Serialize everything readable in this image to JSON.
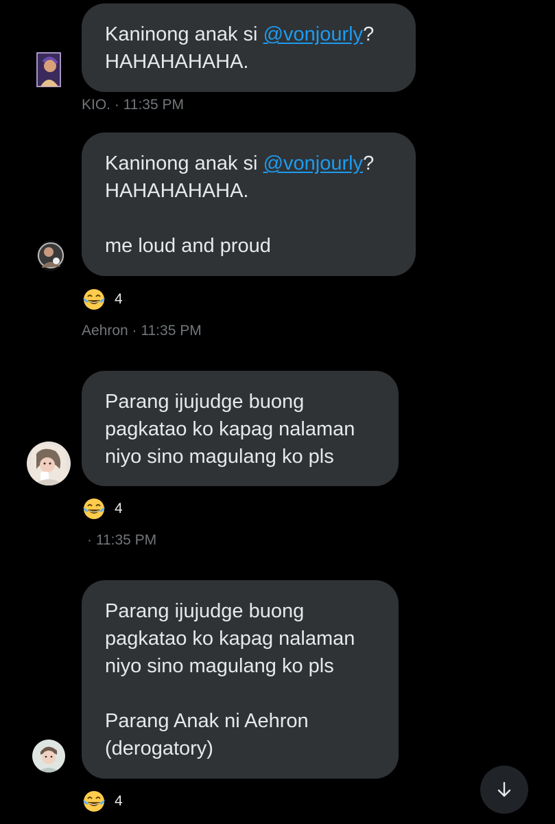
{
  "messages": [
    {
      "lines": [
        "Kaninong anak si ",
        "@vonjourly",
        "?",
        "HAHAHAHAHA."
      ],
      "sender": "KIO.",
      "time": "· 11:35 PM"
    },
    {
      "line1_pre": "Kaninong anak si ",
      "mention": "@vonjourly",
      "line1_post": "?",
      "line2": "HAHAHAHAHA.",
      "line3": "me loud and proud",
      "reaction": {
        "icon": "tears-of-joy-emoji",
        "count": "4"
      },
      "sender": "Aehron",
      "time": "· 11:35 PM"
    },
    {
      "line1": "Parang ijujudge buong",
      "line2": "pagkatao ko kapag nalaman",
      "line3": "niyo sino magulang ko pls",
      "reaction": {
        "icon": "tears-of-joy-emoji",
        "count": "4"
      },
      "sender": "",
      "time": "· 11:35 PM"
    },
    {
      "line1": "Parang ijujudge buong",
      "line2": "pagkatao ko kapag nalaman",
      "line3": "niyo sino magulang ko pls",
      "line4": "Parang Anak ni Aehron",
      "line5": "(derogatory)",
      "reaction": {
        "icon": "tears-of-joy-emoji",
        "count": "4"
      }
    }
  ],
  "m1": {
    "text_pre": "Kaninong anak si ",
    "mention": "@vonjourly",
    "text_post": "?",
    "line2": "HAHAHAHAHA.",
    "meta": "KIO. · 11:35 PM"
  },
  "m2": {
    "meta": "Aehron · 11:35 PM"
  },
  "m3": {
    "meta": "· 11:35 PM"
  },
  "scroll_button": {
    "icon": "arrow-down-icon"
  },
  "colors": {
    "background": "#000000",
    "bubble": "#2f3336",
    "text": "#e7e9ea",
    "link": "#1d9bf0",
    "meta": "#71767b"
  }
}
